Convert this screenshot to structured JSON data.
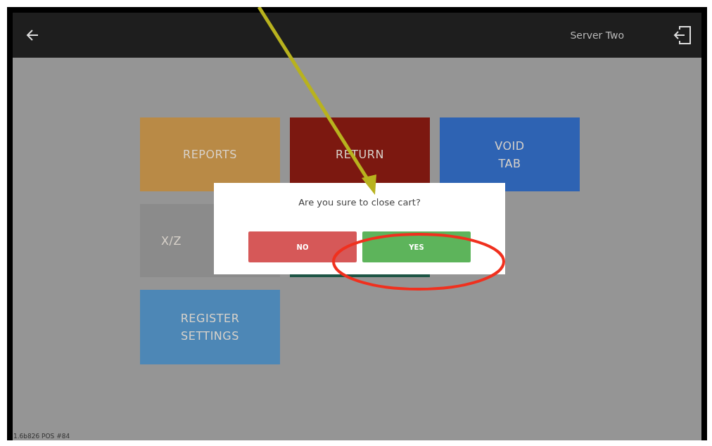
{
  "top_bar": {
    "user": "Server Two"
  },
  "tiles": [
    {
      "label": "REPORTS",
      "color": "#b98a46"
    },
    {
      "label": "RETURN",
      "color": "#7c1810"
    },
    {
      "label": "VOID\nTAB",
      "color": "#2e63b3"
    },
    {
      "label": "X/Z",
      "color": "#8b8b8b"
    },
    {
      "color": "#1d5545"
    },
    {
      "label": "REGISTER\nSETTINGS",
      "color": "#4d87b6"
    }
  ],
  "dialog": {
    "message": "Are you sure to close cart?",
    "buttons": [
      {
        "label": "NO",
        "kind": "cancel"
      },
      {
        "label": "YES",
        "kind": "confirm"
      }
    ]
  },
  "status_bar": {
    "version": "1.6b826 POS #84"
  }
}
